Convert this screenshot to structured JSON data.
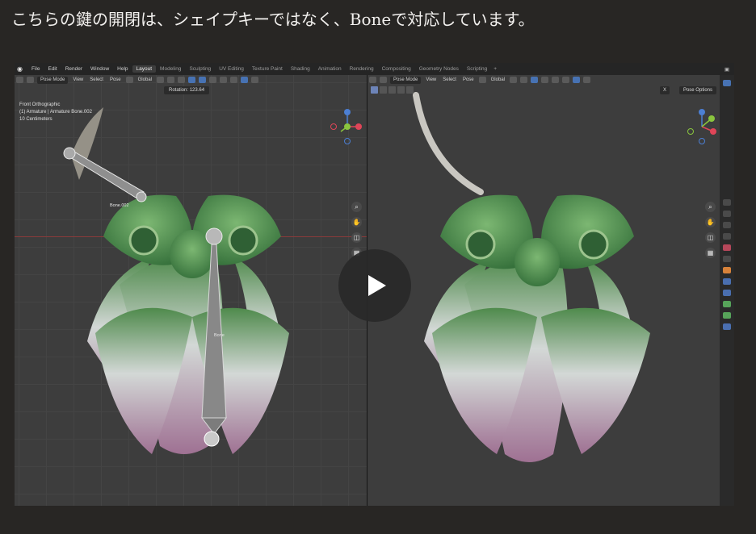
{
  "caption": "こちらの鍵の開閉は、シェイプキーではなく、Boneで対応しています。",
  "topbar": {
    "menus": [
      "File",
      "Edit",
      "Render",
      "Window",
      "Help"
    ],
    "workspaces": [
      "Layout",
      "Modeling",
      "Sculpting",
      "UV Editing",
      "Texture Paint",
      "Shading",
      "Animation",
      "Rendering",
      "Compositing",
      "Geometry Nodes",
      "Scripting"
    ],
    "active_workspace": "Layout",
    "add_label": "+"
  },
  "left_view": {
    "header": {
      "mode": "Pose Mode",
      "menus": [
        "View",
        "Select",
        "Pose"
      ],
      "orientation": "Global"
    },
    "rotation_label": "Rotation:",
    "rotation_value": "123.64",
    "overlay_lines": [
      "Front Orthographic",
      "(1) Armature | Armature Bone.002",
      "10 Centimeters"
    ],
    "bone_labels": [
      "Bone.002",
      "Bone"
    ]
  },
  "right_view": {
    "header": {
      "mode": "Pose Mode",
      "menus": [
        "View",
        "Select",
        "Pose"
      ],
      "orientation": "Global"
    },
    "pose_options": "Pose Options",
    "x_button": "X"
  },
  "gizmo_axes": [
    "Z",
    "Y",
    "X"
  ],
  "nav_icons": [
    "zoom-icon",
    "hand-icon",
    "camera-icon",
    "grid-icon"
  ],
  "colors": {
    "x_axis": "#e04558",
    "y_axis": "#8ac53e",
    "z_axis": "#4c7fd3",
    "accent": "#4772b3",
    "lotus_green": "#4f8a4c",
    "lotus_pink": "#9f7193"
  }
}
